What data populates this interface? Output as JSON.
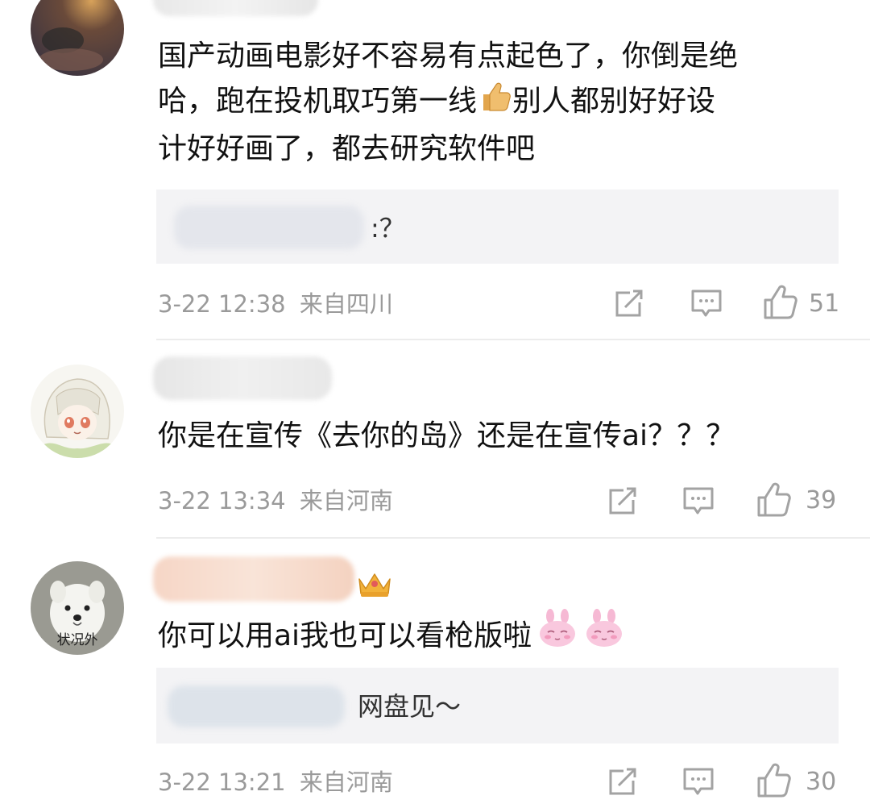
{
  "comments": [
    {
      "text_lines": [
        "国产动画电影好不容易有点起色了，你倒是绝",
        "哈，跑在投机取巧第一线",
        "别人都别好好设",
        "计好好画了，都去研究软件吧"
      ],
      "reply": ":？",
      "time": "3-22 12:38",
      "location": "来自四川",
      "likes": "51"
    },
    {
      "text": "你是在宣传《去你的岛》还是在宣传ai？？？",
      "time": "3-22 13:34",
      "location": "来自河南",
      "likes": "39"
    },
    {
      "avatar_caption": "状况外",
      "text": "你可以用ai我也可以看枪版啦",
      "reply": "网盘见～",
      "time": "3-22 13:21",
      "location": "来自河南",
      "likes": "30"
    }
  ],
  "icons": {
    "share": "share-icon",
    "comment": "comment-icon",
    "like": "thumbs-up-icon",
    "thumbs_emoji": "thumbs-up-emoji-icon",
    "bunny_emoji": "pink-bunny-emoji-icon",
    "crown": "crown-badge-icon"
  }
}
